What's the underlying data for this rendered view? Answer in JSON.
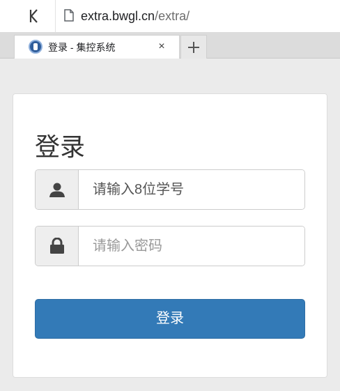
{
  "browser": {
    "url_host": "extra.bwgl.cn",
    "url_path": "/extra/",
    "tab_title": "登录 - 集控系统",
    "close_glyph": "×",
    "icons": {
      "back": "back-arrow-icon",
      "page": "page-icon",
      "favicon": "site-favicon-icon",
      "new_tab": "plus-icon"
    }
  },
  "login": {
    "heading": "登录",
    "username_placeholder": "请输入8位学号",
    "password_placeholder": "请输入密码",
    "submit_label": "登录",
    "icons": {
      "user": "user-icon",
      "lock": "lock-icon"
    }
  },
  "colors": {
    "primary": "#337ab7",
    "page_background": "#ebebeb",
    "addon_background": "#eeeeee"
  }
}
